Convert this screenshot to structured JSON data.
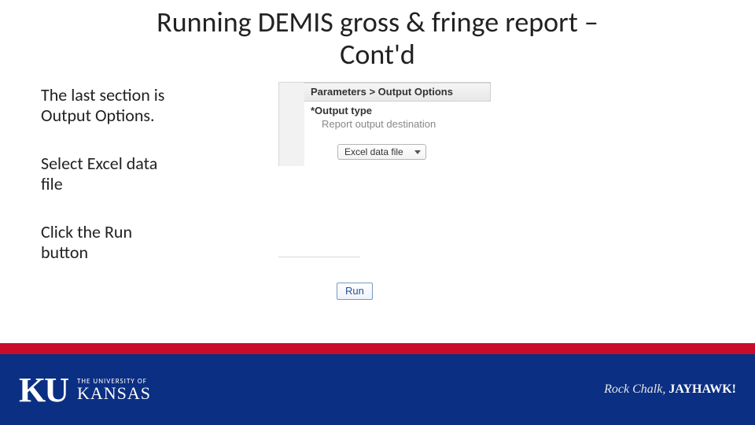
{
  "title_line1": "Running DEMIS gross & fringe report –",
  "title_line2": "Cont'd",
  "instructions": {
    "p1": "The last section is Output Options.",
    "p2": "Select Excel data file",
    "p3": "Click the Run button"
  },
  "panel": {
    "breadcrumb": "Parameters > Output Options",
    "output_type_label": "*Output type",
    "output_type_desc": "Report output destination",
    "dropdown_value": "Excel data file"
  },
  "run_label": "Run",
  "footer": {
    "logo_mark": "KU",
    "logo_line1": "THE UNIVERSITY OF",
    "logo_line2": "KANSAS",
    "slogan_prefix": "Rock Chalk,",
    "slogan_emph": "JAYHAWK!"
  }
}
